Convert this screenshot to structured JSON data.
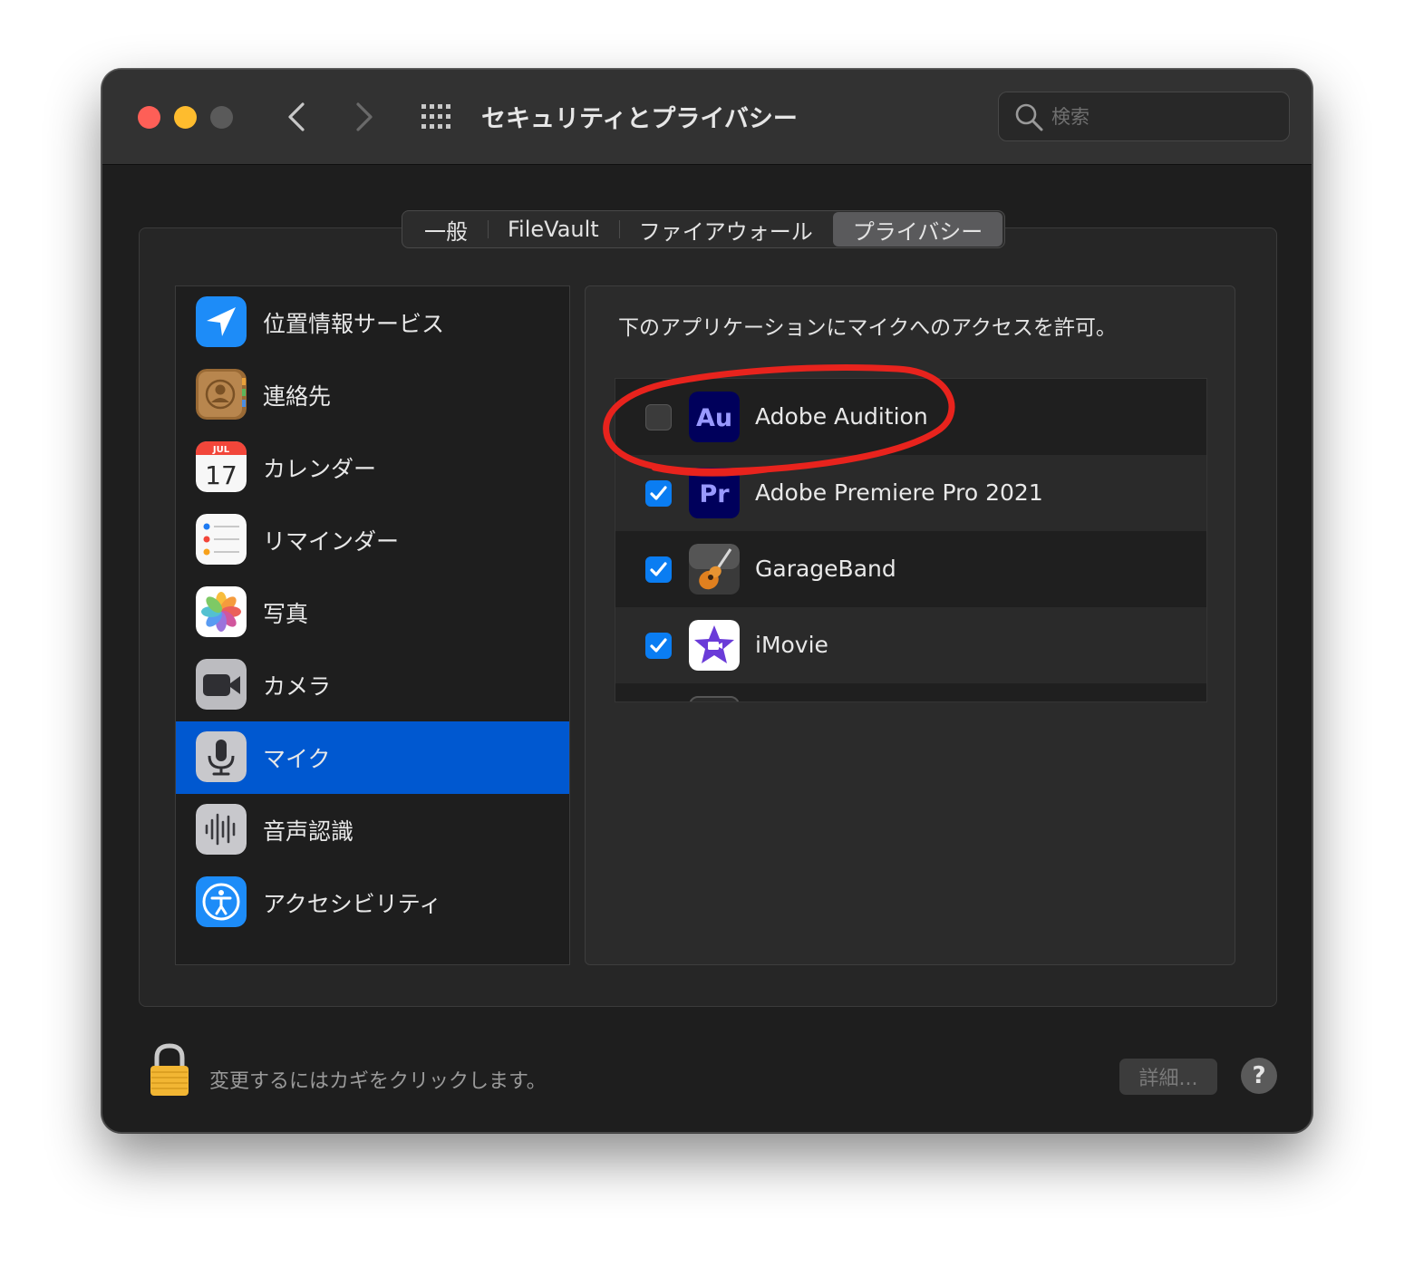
{
  "window": {
    "title": "セキュリティとプライバシー",
    "search_placeholder": "検索"
  },
  "tabs": [
    {
      "label": "一般",
      "active": false
    },
    {
      "label": "FileVault",
      "active": false
    },
    {
      "label": "ファイアウォール",
      "active": false
    },
    {
      "label": "プライバシー",
      "active": true
    }
  ],
  "sidebar": {
    "items": [
      {
        "label": "位置情報サービス",
        "icon": "location-arrow-icon",
        "selected": false
      },
      {
        "label": "連絡先",
        "icon": "contacts-icon",
        "selected": false
      },
      {
        "label": "カレンダー",
        "icon": "calendar-icon",
        "selected": false,
        "calendar_month": "JUL",
        "calendar_day": "17"
      },
      {
        "label": "リマインダー",
        "icon": "reminders-icon",
        "selected": false
      },
      {
        "label": "写真",
        "icon": "photos-icon",
        "selected": false
      },
      {
        "label": "カメラ",
        "icon": "camera-icon",
        "selected": false
      },
      {
        "label": "マイク",
        "icon": "microphone-icon",
        "selected": true
      },
      {
        "label": "音声認識",
        "icon": "speech-recognition-icon",
        "selected": false
      },
      {
        "label": "アクセシビリティ",
        "icon": "accessibility-icon",
        "selected": false
      }
    ]
  },
  "main": {
    "instruction": "下のアプリケーションにマイクへのアクセスを許可。",
    "apps": [
      {
        "name": "Adobe Audition",
        "icon": "adobe-audition-icon",
        "icon_text": "Au",
        "checked": false
      },
      {
        "name": "Adobe Premiere Pro 2021",
        "icon": "adobe-premiere-icon",
        "icon_text": "Pr",
        "checked": true
      },
      {
        "name": "GarageBand",
        "icon": "garageband-icon",
        "checked": true
      },
      {
        "name": "iMovie",
        "icon": "imovie-icon",
        "checked": true
      }
    ]
  },
  "footer": {
    "lock_text": "変更するにはカギをクリックします。",
    "advanced_label": "詳細...",
    "help_label": "?"
  },
  "colors": {
    "selection": "#0058d0",
    "checkbox_on": "#0a7df2",
    "annotation": "#e8231d"
  }
}
